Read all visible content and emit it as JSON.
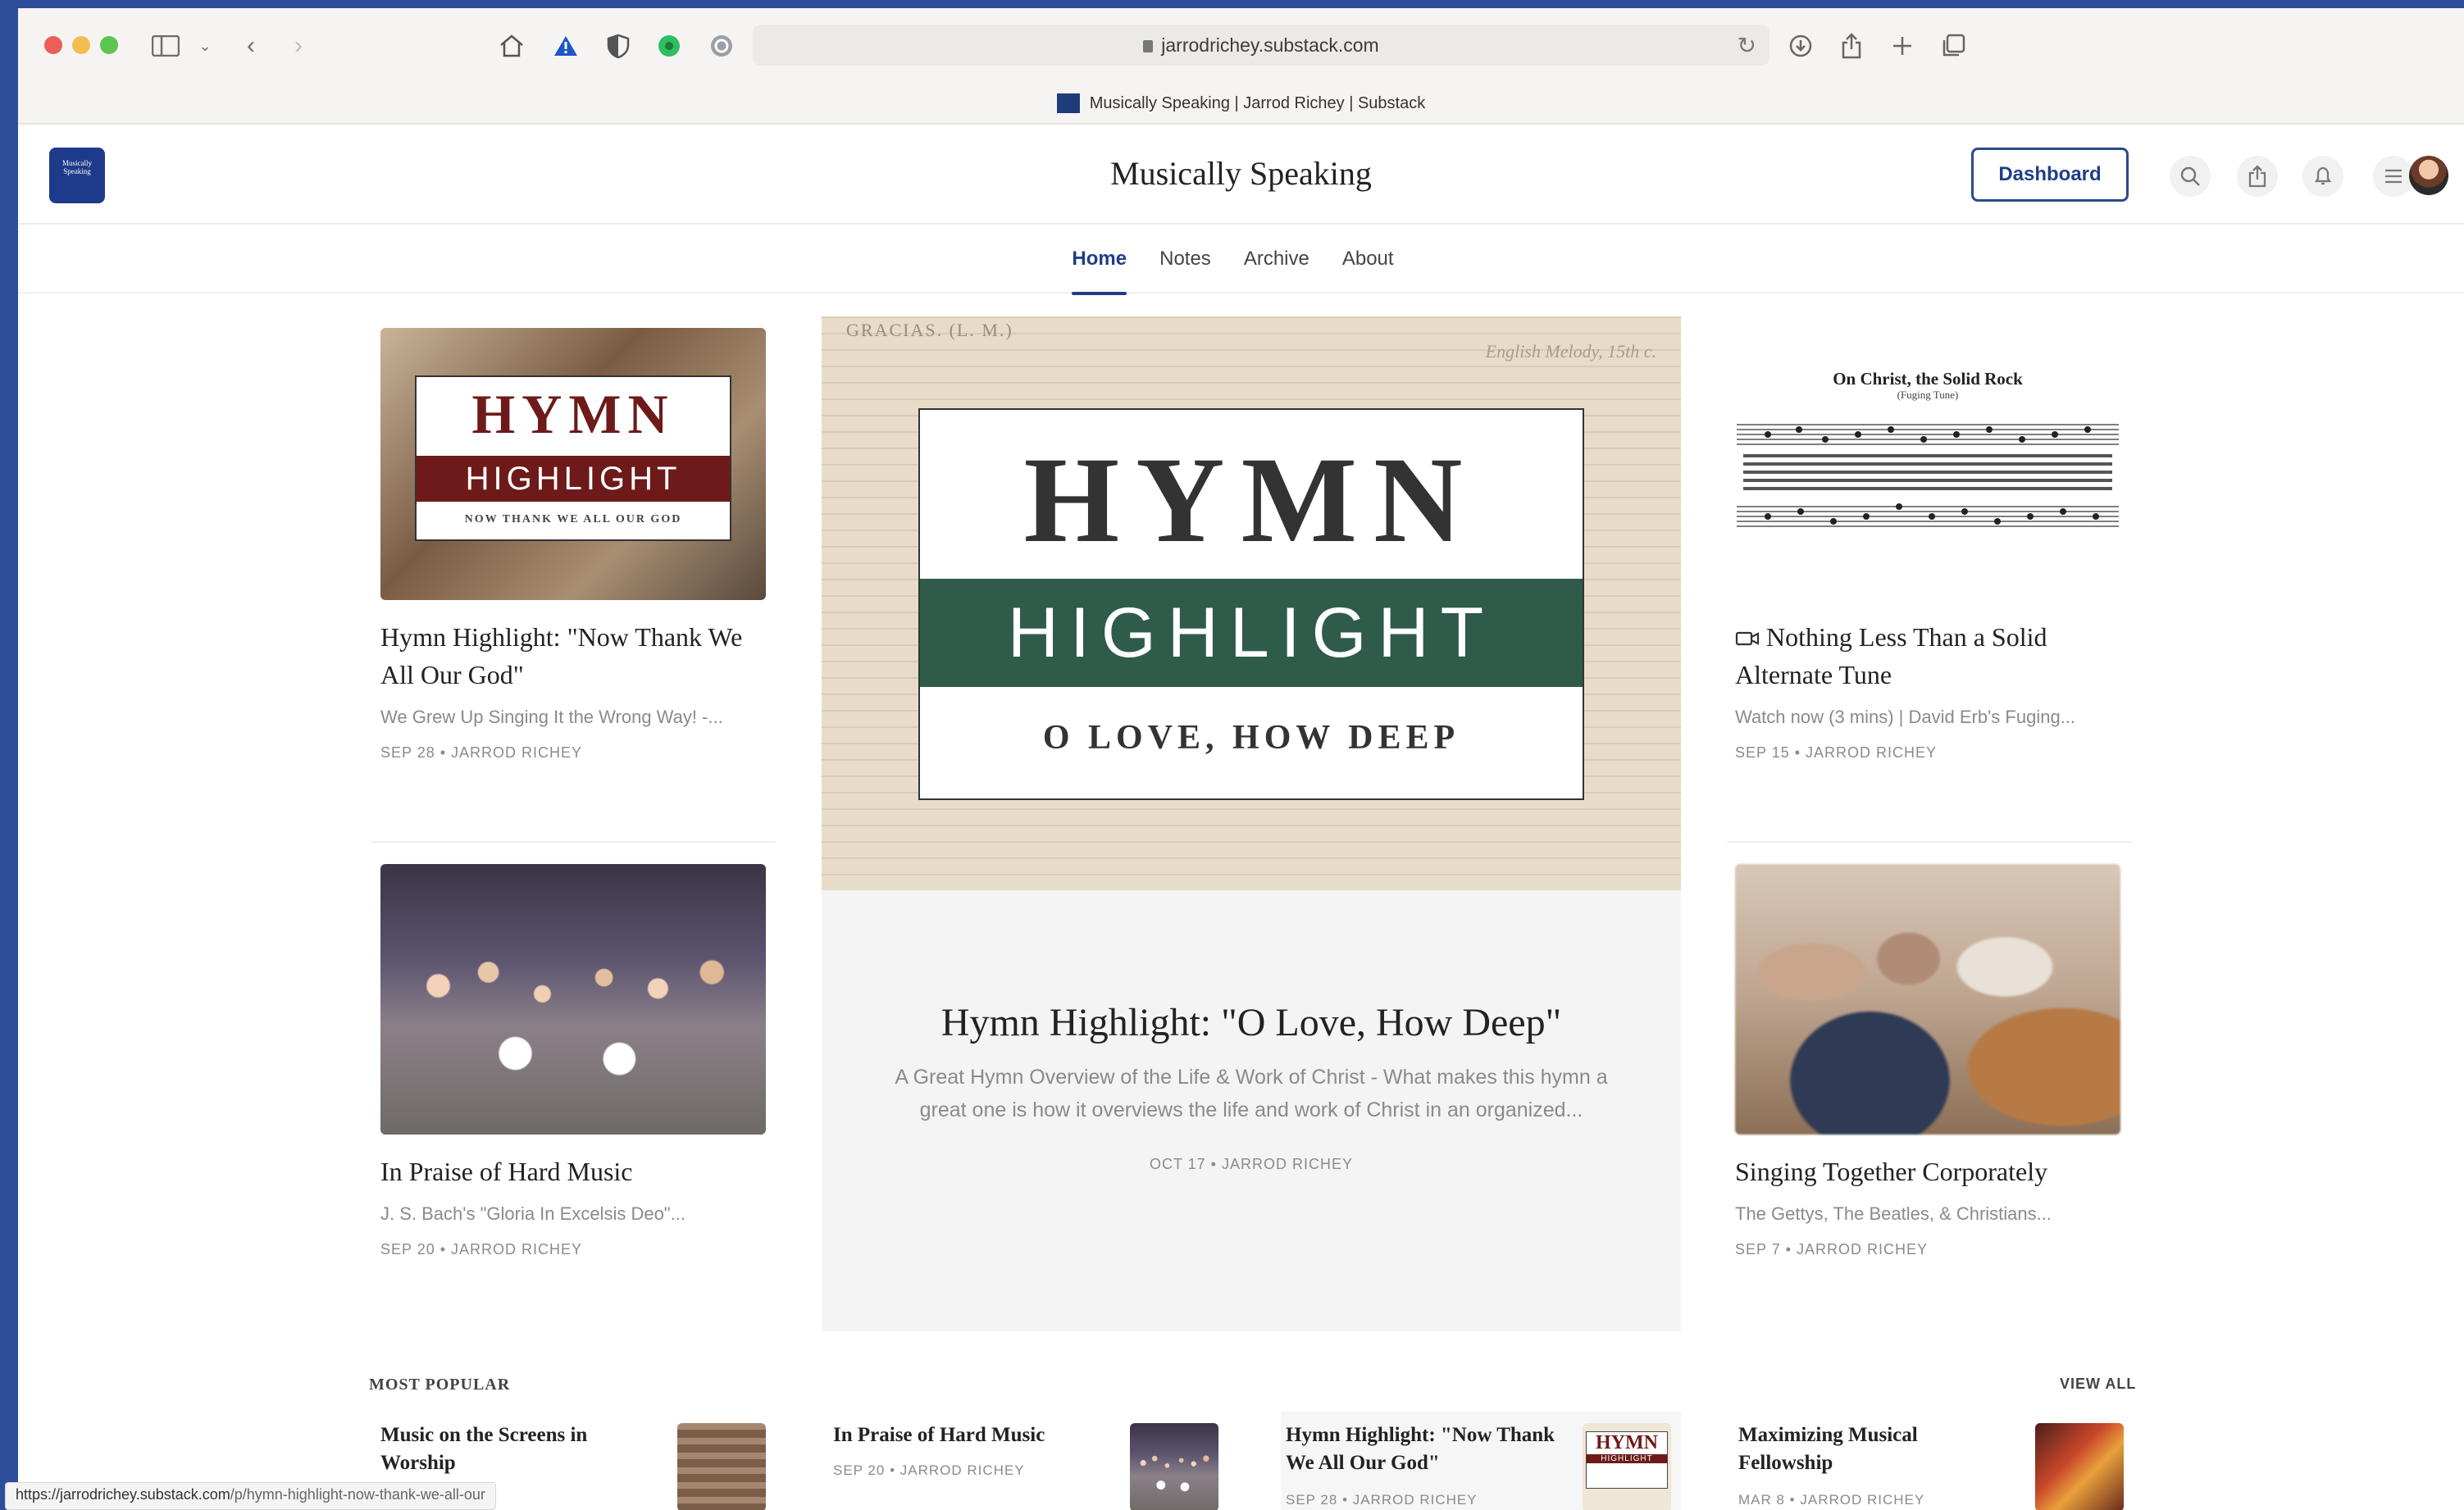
{
  "browser": {
    "url": "jarrodrichey.substack.com",
    "tab_title": "Musically Speaking | Jarrod Richey | Substack",
    "status_url_host": "https://jarrodrichey.substack.com",
    "status_url_path": "/p/hymn-highlight-now-thank-we-all-our"
  },
  "site": {
    "logo_text": "Musically Speaking",
    "title": "Musically Speaking",
    "dashboard_label": "Dashboard"
  },
  "nav": {
    "items": [
      {
        "label": "Home",
        "active": true
      },
      {
        "label": "Notes",
        "active": false
      },
      {
        "label": "Archive",
        "active": false
      },
      {
        "label": "About",
        "active": false
      }
    ]
  },
  "posts": {
    "p1": {
      "title": "Hymn Highlight: \"Now Thank We All Our God\"",
      "subtitle": "We Grew Up Singing It the Wrong Way! -...",
      "meta": "SEP 28 • JARROD RICHEY",
      "img": {
        "word1": "HYMN",
        "word2": "HIGHLIGHT",
        "word3": "NOW THANK WE ALL OUR GOD"
      }
    },
    "featured": {
      "title": "Hymn Highlight: \"O Love, How Deep\"",
      "subtitle_line1": "A Great Hymn Overview of the Life & Work of Christ - What makes this hymn a",
      "subtitle_line2": "great one is how it overviews the life and work of Christ in an organized...",
      "meta": "OCT 17 • JARROD RICHEY",
      "img": {
        "word1": "HYMN",
        "word2": "HIGHLIGHT",
        "word3": "O LOVE, HOW DEEP",
        "bg_text_1": "GRACIAS. (L. M.)",
        "bg_text_2": "English Melody, 15th c."
      }
    },
    "p3": {
      "title": "Nothing Less Than a Solid Alternate Tune",
      "subtitle": "Watch now (3 mins) | David Erb's Fuging...",
      "meta": "SEP 15 • JARROD RICHEY",
      "img": {
        "score_title": "On Christ, the Solid Rock",
        "score_subtitle": "(Fuging Tune)"
      }
    },
    "p4": {
      "title": "In Praise of Hard Music",
      "subtitle": "J. S. Bach's \"Gloria In Excelsis Deo\"...",
      "meta": "SEP 20 • JARROD RICHEY"
    },
    "p5": {
      "title": "Singing Together Corporately",
      "subtitle": "The Gettys, The Beatles, & Christians...",
      "meta": "SEP 7 • JARROD RICHEY"
    }
  },
  "most_popular": {
    "label": "MOST POPULAR",
    "view_all": "VIEW ALL",
    "items": [
      {
        "title_l1": "Music on the Screens in",
        "title_l2": "Worship",
        "meta": ""
      },
      {
        "title_l1": "In Praise of Hard Music",
        "title_l2": "",
        "meta": "SEP 20 • JARROD RICHEY"
      },
      {
        "title_l1": "Hymn Highlight: \"Now Thank",
        "title_l2": "We All Our God\"",
        "meta": "SEP 28 • JARROD RICHEY"
      },
      {
        "title_l1": "Maximizing Musical",
        "title_l2": "Fellowship",
        "meta": "MAR 8 • JARROD RICHEY"
      }
    ],
    "thumb3": {
      "word1": "HYMN",
      "word2": "HIGHLIGHT"
    }
  },
  "colors": {
    "accent": "#1f3f85",
    "hymn_red": "#6e1a1a",
    "hymn_green": "#2f5b4b"
  }
}
